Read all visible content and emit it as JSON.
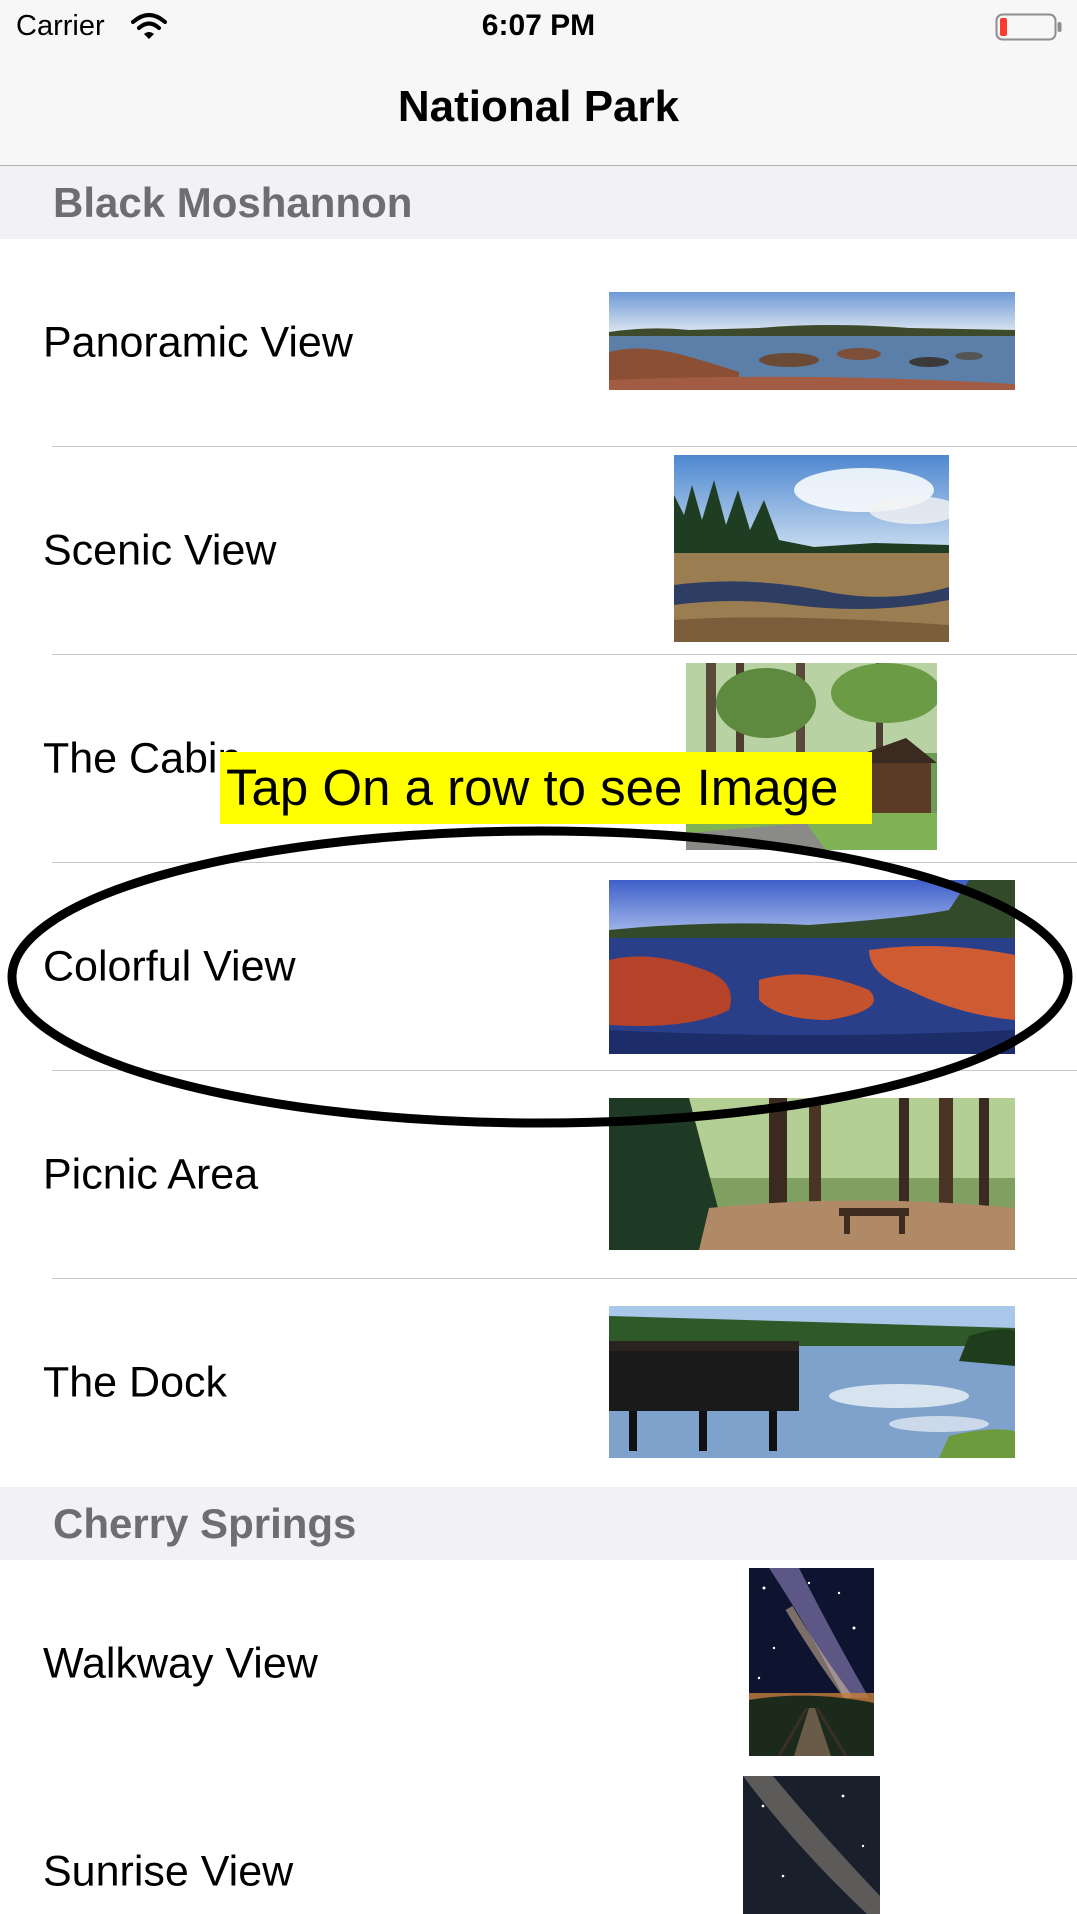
{
  "status_bar": {
    "carrier": "Carrier",
    "time": "6:07 PM",
    "icons": [
      "wifi-icon",
      "battery-low-icon"
    ],
    "battery_color": "#ff3b30"
  },
  "nav": {
    "title": "National Park"
  },
  "sections": [
    {
      "title": "Black Moshannon",
      "rows": [
        {
          "label": "Panoramic View",
          "image": "panoramic-lake-thumbnail"
        },
        {
          "label": "Scenic View",
          "image": "scenic-marsh-thumbnail"
        },
        {
          "label": "The Cabin",
          "image": "cabin-forest-thumbnail"
        },
        {
          "label": "Colorful View",
          "image": "colorful-bog-thumbnail"
        },
        {
          "label": "Picnic Area",
          "image": "picnic-area-thumbnail"
        },
        {
          "label": "The Dock",
          "image": "dock-lake-thumbnail"
        }
      ]
    },
    {
      "title": "Cherry Springs",
      "rows": [
        {
          "label": "Walkway View",
          "image": "milky-way-walkway-thumbnail"
        },
        {
          "label": "Sunrise View",
          "image": "night-sky-thumbnail"
        }
      ]
    }
  ],
  "overlay": {
    "hint": "Tap On a row to see Image",
    "hint_color": "#ffff00",
    "highlighted_row": "Colorful View"
  }
}
